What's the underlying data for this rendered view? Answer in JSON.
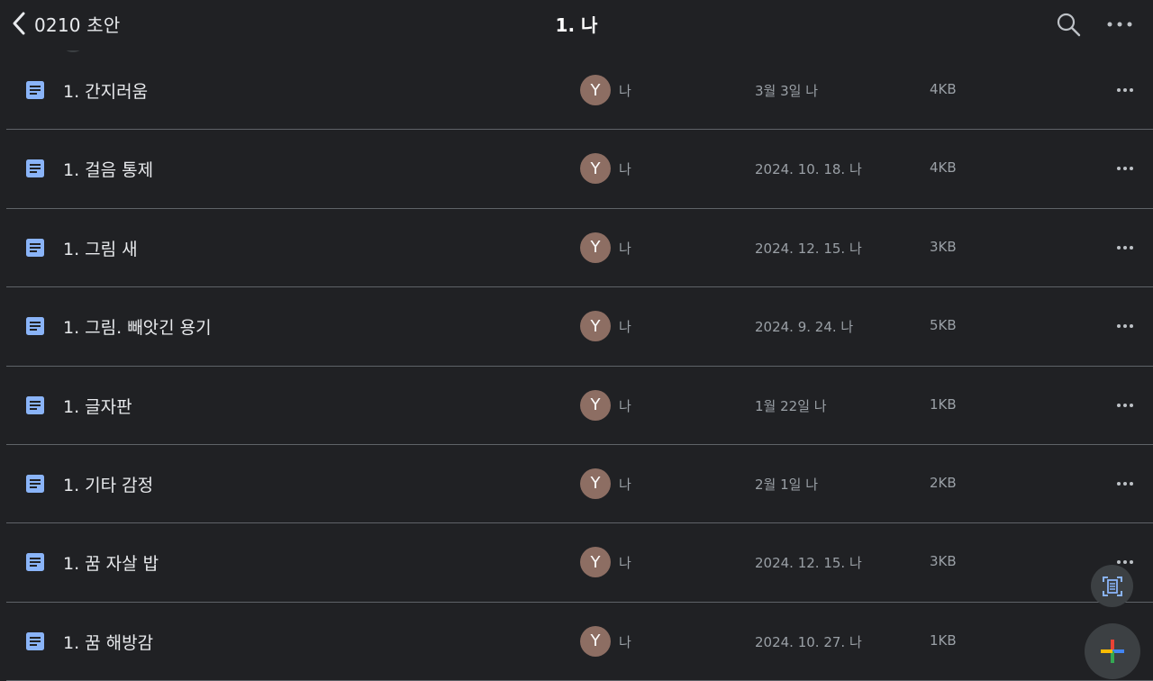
{
  "header": {
    "back_label": "0210 초안",
    "title": "1. 나"
  },
  "files": [
    {
      "name": "1. 간지러움",
      "avatar": "Y",
      "owner": "나",
      "modified": "3월 3일 나",
      "size": "4KB"
    },
    {
      "name": "1. 걸음 통제",
      "avatar": "Y",
      "owner": "나",
      "modified": "2024. 10. 18. 나",
      "size": "4KB"
    },
    {
      "name": "1. 그림 새",
      "avatar": "Y",
      "owner": "나",
      "modified": "2024. 12. 15. 나",
      "size": "3KB"
    },
    {
      "name": "1. 그림. 빼앗긴 용기",
      "avatar": "Y",
      "owner": "나",
      "modified": "2024. 9. 24. 나",
      "size": "5KB"
    },
    {
      "name": "1. 글자판",
      "avatar": "Y",
      "owner": "나",
      "modified": "1월 22일 나",
      "size": "1KB"
    },
    {
      "name": "1. 기타 감정",
      "avatar": "Y",
      "owner": "나",
      "modified": "2월 1일 나",
      "size": "2KB"
    },
    {
      "name": "1. 꿈 자살 밥",
      "avatar": "Y",
      "owner": "나",
      "modified": "2024. 12. 15. 나",
      "size": "3KB"
    },
    {
      "name": "1. 꿈 해방감",
      "avatar": "Y",
      "owner": "나",
      "modified": "2024. 10. 27. 나",
      "size": "1KB"
    }
  ],
  "icons": {
    "back": "chevron-left-icon",
    "search": "search-icon",
    "more": "more-horizontal-icon",
    "doc": "google-docs-icon",
    "scan": "scan-document-icon",
    "new": "plus-icon"
  },
  "colors": {
    "background": "#202124",
    "doc_icon": "#8ab4f8",
    "avatar": "#8d6e63",
    "divider": "#5f6368"
  }
}
